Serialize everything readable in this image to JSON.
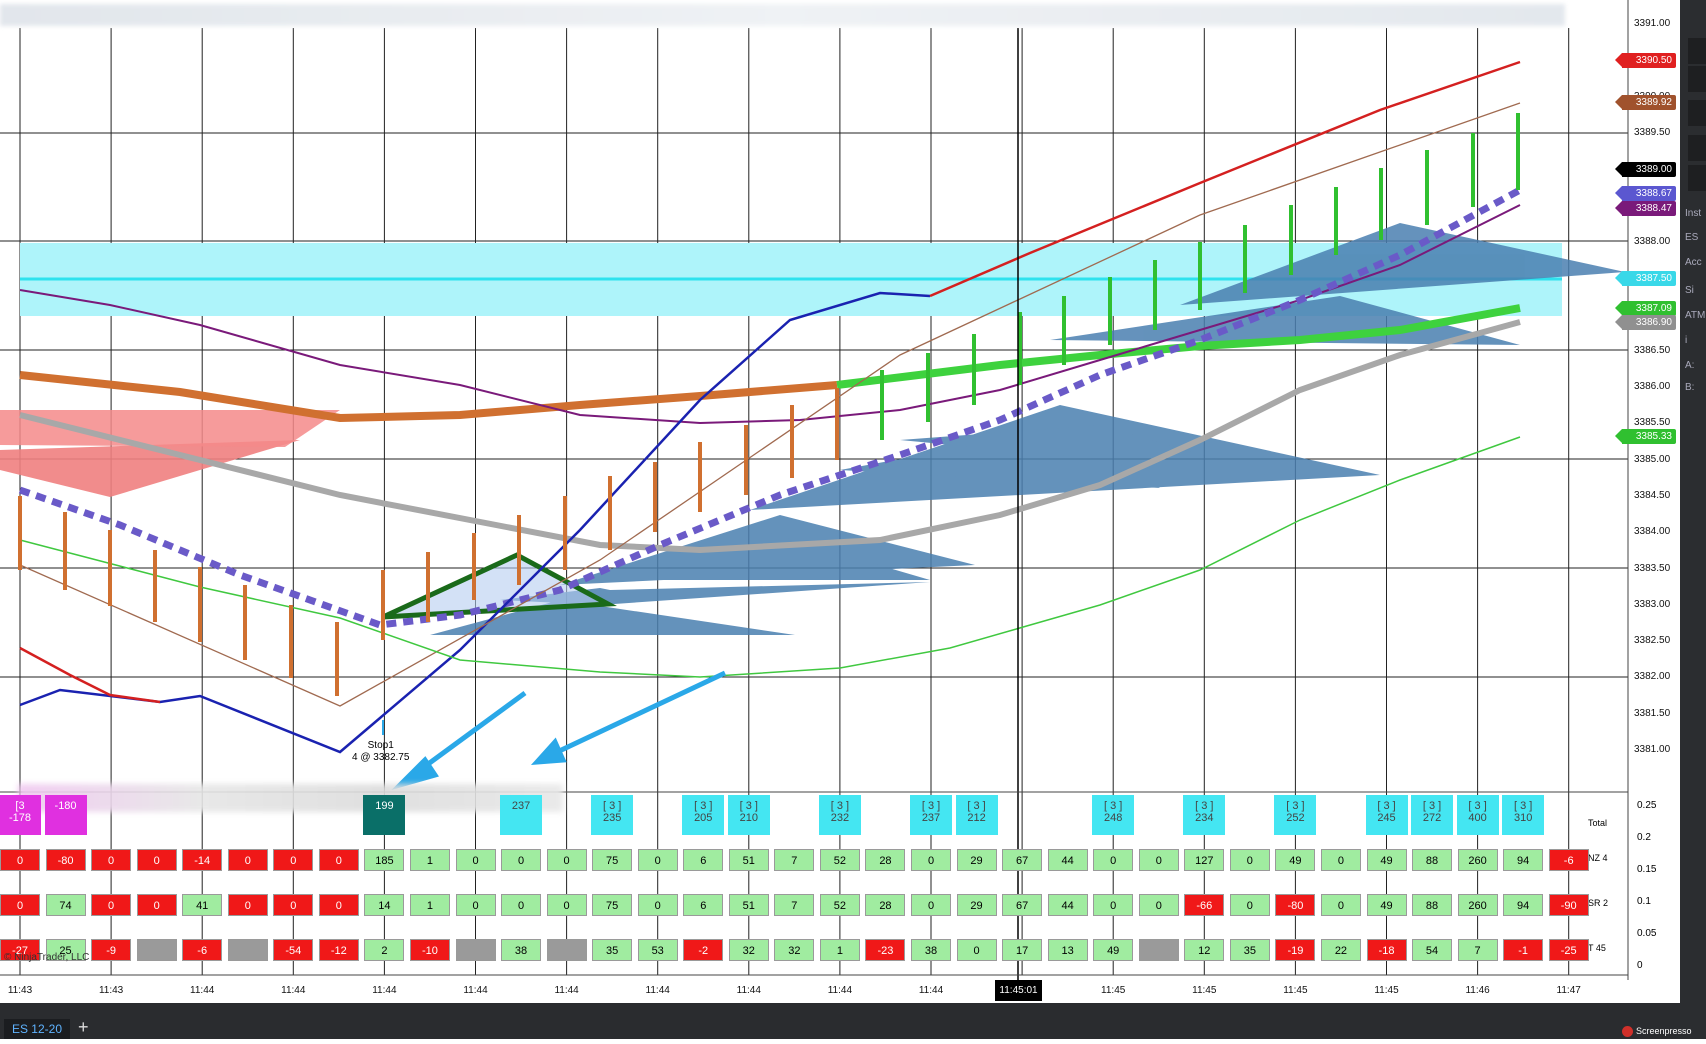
{
  "instrument_tab": "ES 12-20",
  "add_tab_label": "+",
  "price_axis": [
    "3391.00",
    "3390.50",
    "3390.00",
    "3389.50",
    "3389.00",
    "3388.50",
    "3388.00",
    "3387.50",
    "3387.00",
    "3386.50",
    "3386.00",
    "3385.50",
    "3385.00",
    "3384.50",
    "3384.00",
    "3383.50",
    "3383.00",
    "3382.50",
    "3382.00",
    "3381.50",
    "3381.00"
  ],
  "price_tags": [
    {
      "value": "3390.50",
      "color": "#e02020"
    },
    {
      "value": "3389.92",
      "color": "#a0522d"
    },
    {
      "value": "3389.00",
      "color": "#000000"
    },
    {
      "value": "3388.67",
      "color": "#5b57d0"
    },
    {
      "value": "3388.47",
      "color": "#7a1a7a"
    },
    {
      "value": "3387.50",
      "color": "#39d8e8"
    },
    {
      "value": "3387.09",
      "color": "#30c030"
    },
    {
      "value": "3386.90",
      "color": "#909090"
    },
    {
      "value": "3385.33",
      "color": "#30c030"
    }
  ],
  "time_axis": [
    "11:43",
    "11:43",
    "11:44",
    "11:44",
    "11:44",
    "11:44",
    "11:44",
    "11:44",
    "11:44",
    "11:44",
    "11:44",
    "11:45:01",
    "11:45",
    "11:45",
    "11:45",
    "11:45",
    "11:46",
    "11:47"
  ],
  "time_cursor": "11:45:01",
  "stop_label": {
    "line1": "Stop1",
    "line2": "4 @ 3382.75"
  },
  "copyright": "© NinjaTrader, LLC",
  "oscillator_axis": [
    "0.25",
    "0.2",
    "0.15",
    "0.1",
    "0.05",
    "0"
  ],
  "row_labels": {
    "total": "Total",
    "nz": "NZ 4",
    "sr": "SR 2",
    "t": "T 45"
  },
  "total_row": [
    {
      "idx": 0,
      "top": "[3",
      "value": "-178",
      "style": "magenta"
    },
    {
      "idx": 1,
      "top": "",
      "value": "-180",
      "style": "magenta"
    },
    {
      "idx": 8,
      "top": "",
      "value": "199",
      "style": "teal"
    },
    {
      "idx": 11,
      "top": "",
      "value": "237",
      "style": "cyan"
    },
    {
      "idx": 13,
      "top": "[ 3 ]",
      "value": "235",
      "style": "cyan"
    },
    {
      "idx": 15,
      "top": "[ 3 ]",
      "value": "205",
      "style": "cyan"
    },
    {
      "idx": 16,
      "top": "[ 3 ]",
      "value": "210",
      "style": "cyan"
    },
    {
      "idx": 18,
      "top": "[ 3 ]",
      "value": "232",
      "style": "cyan"
    },
    {
      "idx": 20,
      "top": "[ 3 ]",
      "value": "237",
      "style": "cyan"
    },
    {
      "idx": 21,
      "top": "[ 3 ]",
      "value": "212",
      "style": "cyan"
    },
    {
      "idx": 24,
      "top": "[ 3 ]",
      "value": "248",
      "style": "cyan"
    },
    {
      "idx": 26,
      "top": "[ 3 ]",
      "value": "234",
      "style": "cyan"
    },
    {
      "idx": 28,
      "top": "[ 3 ]",
      "value": "252",
      "style": "cyan"
    },
    {
      "idx": 30,
      "top": "[ 3 ]",
      "value": "245",
      "style": "cyan"
    },
    {
      "idx": 31,
      "top": "[ 3 ]",
      "value": "272",
      "style": "cyan"
    },
    {
      "idx": 32,
      "top": "[ 3 ]",
      "value": "400",
      "style": "cyan"
    },
    {
      "idx": 33,
      "top": "[ 3 ]",
      "value": "310",
      "style": "cyan"
    }
  ],
  "nz_row": [
    {
      "v": "0",
      "c": "red"
    },
    {
      "v": "-80",
      "c": "red"
    },
    {
      "v": "0",
      "c": "red"
    },
    {
      "v": "0",
      "c": "red"
    },
    {
      "v": "-14",
      "c": "red"
    },
    {
      "v": "0",
      "c": "red"
    },
    {
      "v": "0",
      "c": "red"
    },
    {
      "v": "0",
      "c": "red"
    },
    {
      "v": "185",
      "c": "green"
    },
    {
      "v": "1",
      "c": "green"
    },
    {
      "v": "0",
      "c": "green"
    },
    {
      "v": "0",
      "c": "green"
    },
    {
      "v": "0",
      "c": "green"
    },
    {
      "v": "75",
      "c": "green"
    },
    {
      "v": "0",
      "c": "green"
    },
    {
      "v": "6",
      "c": "green"
    },
    {
      "v": "51",
      "c": "green"
    },
    {
      "v": "7",
      "c": "green"
    },
    {
      "v": "52",
      "c": "green"
    },
    {
      "v": "28",
      "c": "green"
    },
    {
      "v": "0",
      "c": "green"
    },
    {
      "v": "29",
      "c": "green"
    },
    {
      "v": "67",
      "c": "green"
    },
    {
      "v": "44",
      "c": "green"
    },
    {
      "v": "0",
      "c": "green"
    },
    {
      "v": "0",
      "c": "green"
    },
    {
      "v": "127",
      "c": "green"
    },
    {
      "v": "0",
      "c": "green"
    },
    {
      "v": "49",
      "c": "green"
    },
    {
      "v": "0",
      "c": "green"
    },
    {
      "v": "49",
      "c": "green"
    },
    {
      "v": "88",
      "c": "green"
    },
    {
      "v": "260",
      "c": "green"
    },
    {
      "v": "94",
      "c": "green"
    },
    {
      "v": "-6",
      "c": "red"
    }
  ],
  "sr_row": [
    {
      "v": "0",
      "c": "red"
    },
    {
      "v": "74",
      "c": "green"
    },
    {
      "v": "0",
      "c": "red"
    },
    {
      "v": "0",
      "c": "red"
    },
    {
      "v": "41",
      "c": "green"
    },
    {
      "v": "0",
      "c": "red"
    },
    {
      "v": "0",
      "c": "red"
    },
    {
      "v": "0",
      "c": "red"
    },
    {
      "v": "14",
      "c": "green"
    },
    {
      "v": "1",
      "c": "green"
    },
    {
      "v": "0",
      "c": "green"
    },
    {
      "v": "0",
      "c": "green"
    },
    {
      "v": "0",
      "c": "green"
    },
    {
      "v": "75",
      "c": "green"
    },
    {
      "v": "0",
      "c": "green"
    },
    {
      "v": "6",
      "c": "green"
    },
    {
      "v": "51",
      "c": "green"
    },
    {
      "v": "7",
      "c": "green"
    },
    {
      "v": "52",
      "c": "green"
    },
    {
      "v": "28",
      "c": "green"
    },
    {
      "v": "0",
      "c": "green"
    },
    {
      "v": "29",
      "c": "green"
    },
    {
      "v": "67",
      "c": "green"
    },
    {
      "v": "44",
      "c": "green"
    },
    {
      "v": "0",
      "c": "green"
    },
    {
      "v": "0",
      "c": "green"
    },
    {
      "v": "-66",
      "c": "red"
    },
    {
      "v": "0",
      "c": "green"
    },
    {
      "v": "-80",
      "c": "red"
    },
    {
      "v": "0",
      "c": "green"
    },
    {
      "v": "49",
      "c": "green"
    },
    {
      "v": "88",
      "c": "green"
    },
    {
      "v": "260",
      "c": "green"
    },
    {
      "v": "94",
      "c": "green"
    },
    {
      "v": "-90",
      "c": "red"
    }
  ],
  "t_row": [
    {
      "v": "-27",
      "c": "red"
    },
    {
      "v": "25",
      "c": "green"
    },
    {
      "v": "-9",
      "c": "red"
    },
    {
      "v": "",
      "c": "gray"
    },
    {
      "v": "-6",
      "c": "red"
    },
    {
      "v": "",
      "c": "gray"
    },
    {
      "v": "-54",
      "c": "red"
    },
    {
      "v": "-12",
      "c": "red"
    },
    {
      "v": "2",
      "c": "green"
    },
    {
      "v": "-10",
      "c": "red"
    },
    {
      "v": "",
      "c": "gray"
    },
    {
      "v": "38",
      "c": "green"
    },
    {
      "v": "",
      "c": "gray"
    },
    {
      "v": "35",
      "c": "green"
    },
    {
      "v": "53",
      "c": "green"
    },
    {
      "v": "-2",
      "c": "red"
    },
    {
      "v": "32",
      "c": "green"
    },
    {
      "v": "32",
      "c": "green"
    },
    {
      "v": "1",
      "c": "green"
    },
    {
      "v": "-23",
      "c": "red"
    },
    {
      "v": "38",
      "c": "green"
    },
    {
      "v": "0",
      "c": "green"
    },
    {
      "v": "17",
      "c": "green"
    },
    {
      "v": "13",
      "c": "green"
    },
    {
      "v": "49",
      "c": "green"
    },
    {
      "v": "",
      "c": "gray"
    },
    {
      "v": "12",
      "c": "green"
    },
    {
      "v": "35",
      "c": "green"
    },
    {
      "v": "-19",
      "c": "red"
    },
    {
      "v": "22",
      "c": "green"
    },
    {
      "v": "-18",
      "c": "red"
    },
    {
      "v": "54",
      "c": "green"
    },
    {
      "v": "7",
      "c": "green"
    },
    {
      "v": "-1",
      "c": "red"
    },
    {
      "v": "-25",
      "c": "red"
    }
  ],
  "right_panel": [
    "Inst",
    "ES",
    "Acc",
    "Si",
    "ATM",
    "i",
    "A:",
    "B:"
  ],
  "watermark": "Screenpresso"
}
